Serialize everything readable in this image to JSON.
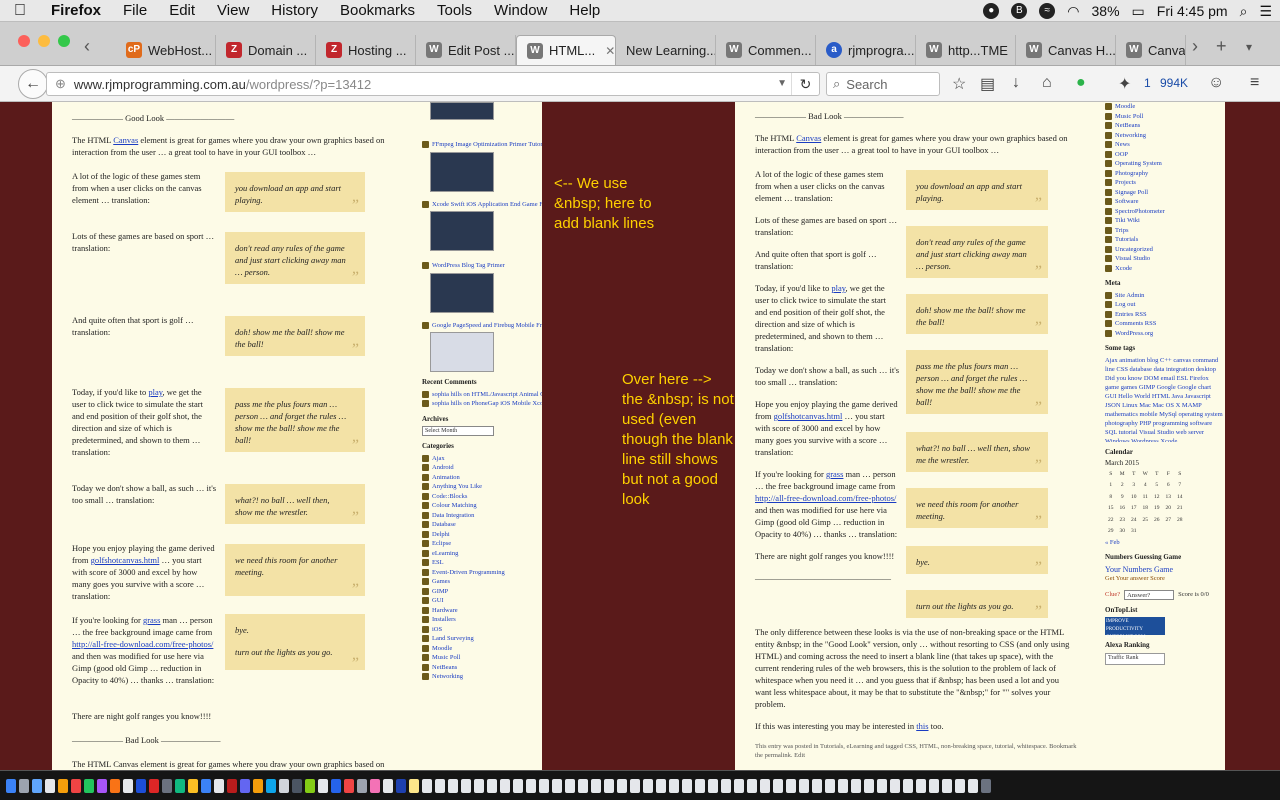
{
  "menubar": {
    "apple": "",
    "items": [
      "Firefox",
      "File",
      "Edit",
      "View",
      "History",
      "Bookmarks",
      "Tools",
      "Window",
      "Help"
    ],
    "battery": "38%",
    "clock": "Fri 4:45 pm"
  },
  "tabs": [
    {
      "label": "WebHost...",
      "icon": "cp-icon"
    },
    {
      "label": "Domain ...",
      "icon": "z-icon"
    },
    {
      "label": "Hosting ...",
      "icon": "z-icon"
    },
    {
      "label": "Edit Post ...",
      "icon": "wp-icon"
    },
    {
      "label": "HTML...",
      "icon": "wp-icon",
      "active": true
    },
    {
      "label": "New Learning...",
      "icon": "blank"
    },
    {
      "label": "Commen...",
      "icon": "wp-icon"
    },
    {
      "label": "rjmprogra...",
      "icon": "a-icon"
    },
    {
      "label": "http...TME",
      "icon": "wp-icon"
    },
    {
      "label": "Canvas H...",
      "icon": "wp-icon"
    },
    {
      "label": "Canvas",
      "icon": "wp-icon"
    }
  ],
  "navbar": {
    "url_host": "www.rjmprogramming.com.au",
    "url_path": "/wordpress/?p=13412",
    "search_placeholder": "Search",
    "badge": "1",
    "size": "994K"
  },
  "good": {
    "heading": "—————— Good Look ————————",
    "p1a": "The HTML ",
    "p1link": "Canvas",
    "p1b": " element is great for games where you draw your own graphics based on interaction from the user … a great tool to have in your GUI toolbox …",
    "p2": "A lot of the logic of these games stem from when a user clicks on the canvas element … translation:",
    "q1": "you download an app and start playing.",
    "p3": "Lots of these games are based on sport … translation:",
    "q2": "don't read any rules of the game and just start clicking away man … person.",
    "p4": "And quite often that sport is golf … translation:",
    "q3": "doh! show me the ball! show me the ball!",
    "p5a": "Today, if you'd like to ",
    "p5link": "play",
    "p5b": ", we get the user to click twice to simulate the start and end position of their golf shot, the direction and size of which is predetermined, and shown to them … translation:",
    "q4": "pass me the plus fours man … person … and forget the rules … show me the ball! show me the ball!",
    "p6": "Today we don't show a ball, as such … it's too small … translation:",
    "q5": "what?! no ball … well then, show me the wrestler.",
    "p7a": "Hope you enjoy playing the game derived from ",
    "p7link": "golfshotcanvas.html",
    "p7b": " … you start with score of 3000 and excel by how many goes you survive with a score … translation:",
    "q6": "we need this room for another meeting.",
    "p8a": "If you're looking for ",
    "p8link": "grass",
    "p8b": " man … person … the free background image came from ",
    "p8link2": "http://all-free-download.com/free-photos/",
    "p8c": " and then was modified for use here via Gimp (good old Gimp … reduction in Opacity to 40%) … thanks … translation:",
    "q7a": "bye.",
    "q7b": "turn out the lights as you go.",
    "p9": "There are night golf ranges you know!!!!",
    "bad_heading": "—————— Bad Look ———————",
    "p10": "The HTML Canvas element is great for games where you draw your own graphics based on"
  },
  "sidebar1": {
    "recent_items": [
      "FFmpeg Image Optimization Primer Tutorial",
      "Xcode Swift iOS Application End Game Follow Up Tutorial",
      "WordPress Blog Tag Primer",
      "Google PageSpeed and Firebug Mobile Friendly Primer Tutorial"
    ],
    "recent_comments_title": "Recent Comments",
    "comments": [
      "sophia hills on HTML/Javascript Animal Categorization Tutorial",
      "sophia hills on PhoneGap iOS Mobile Xcode Primer Tutorial"
    ],
    "archives_title": "Archives",
    "archives_select": "Select Month",
    "categories_title": "Categories",
    "categories": [
      "Ajax",
      "Android",
      "Animation",
      "Anything You Like",
      "Code::Blocks",
      "Colour Matching",
      "Data Integration",
      "Database",
      "Delphi",
      "Eclipse",
      "eLearning",
      "ESL",
      "Event-Driven Programming",
      "Games",
      "GIMP",
      "GUI",
      "Hardware",
      "Installers",
      "iOS",
      "Land Surveying",
      "Moodle",
      "Music Poll",
      "NetBeans",
      "Networking"
    ]
  },
  "notes": {
    "n1": "<-- We use &nbsp; here to add blank lines",
    "n2": "Over here --> the &nbsp; is not used (even though the blank line still shows but not a good look"
  },
  "bad": {
    "heading": "—————— Bad Look ———————",
    "p1a": "The HTML ",
    "p1link": "Canvas",
    "p1b": " element is great for games where you draw your own graphics based on interaction from the user … a great tool to have in your GUI toolbox …",
    "p2": "A lot of the logic of these games stem from when a user clicks on the canvas element … translation:",
    "p3": "Lots of these games are based on sport … translation:",
    "p4": "And quite often that sport is golf … translation:",
    "p5a": "Today, if you'd like to ",
    "p5link": "play",
    "p5b": ", we get the user to click twice to simulate the start and end position of their golf shot, the direction and size of which is predetermined, and shown to them … translation:",
    "p6": "Today we don't show a ball, as such … it's too small … translation:",
    "p7a": "Hope you enjoy playing the game derived from ",
    "p7link": "golfshotcanvas.html",
    "p7b": " … you start with score of 3000 and excel by how many goes you survive with a score … translation:",
    "p8a": "If you're looking for ",
    "p8link": "grass",
    "p8b": " man … person … the free background image came from ",
    "p8link2": "http://all-free-download.com/free-photos/",
    "p8c": " and then was modified for use here via Gimp (good old Gimp … reduction in Opacity to 40%) … thanks … translation:",
    "p9": "There are night golf ranges you know!!!!",
    "sep": "————————————————",
    "p10": "The only difference between these looks is via the use of non-breaking space or the HTML entity &nbsp; in the \"Good Look\" version, only … without resorting to CSS (and only using HTML) and coming across the need to insert a blank line (that takes up space), with the current rendering rules of the web browsers, this is the solution to the problem of lack of whitespace when you need it … and you guess that if &nbsp; has been used a lot and you want less whitespace about, it may be that to substitute the \"&nbsp;\" for \"\" solves your problem.",
    "p11a": "If this was interesting you may be interested in ",
    "p11link": "this",
    "p11b": " too.",
    "footer": "This entry was posted in Tutorials, eLearning and tagged CSS, HTML, non-breaking space, tutorial, whitespace. Bookmark the permalink. Edit",
    "quotes": [
      "you download an app and start playing.",
      "don't read any rules of the game and just start clicking away man … person.",
      "doh! show me the ball! show me the ball!",
      "pass me the plus fours man … person … and forget the rules … show me the ball! show me the ball!",
      "what?! no ball … well then, show me the wrestler.",
      "we need this room for another meeting.",
      "bye.",
      "turn out the lights as you go."
    ]
  },
  "sidebar2": {
    "cats": [
      "Moodle",
      "Music Poll",
      "NetBeans",
      "Networking",
      "News",
      "OOP",
      "Operating System",
      "Photography",
      "Projects",
      "Signage Poll",
      "Software",
      "SpectroPhotometer",
      "Tiki Wiki",
      "Trips",
      "Tutorials",
      "Uncategorized",
      "Visual Studio",
      "Xcode"
    ],
    "meta_title": "Meta",
    "meta": [
      "Site Admin",
      "Log out",
      "Entries RSS",
      "Comments RSS",
      "WordPress.org"
    ],
    "tags_title": "Some tags",
    "tags": "Ajax animation blog C++ canvas command line CSS database data integration desktop Did you know DOM email ESL Firefox game games GIMP Google Google chart GUI Hello World HTML Java Javascript JSON Linux Mac Mac OS X MAMP mathematics mobile MySql operating system photography PHP programming software SQL tutorial Visual Studio web server Windows Wordpress Xcode",
    "cal_title": "Calendar",
    "cal_month": "March 2015",
    "cal_days": [
      "S",
      "M",
      "T",
      "W",
      "T",
      "F",
      "S"
    ],
    "cal_rows": [
      [
        "1",
        "2",
        "3",
        "4",
        "5",
        "6",
        "7"
      ],
      [
        "8",
        "9",
        "10",
        "11",
        "12",
        "13",
        "14"
      ],
      [
        "15",
        "16",
        "17",
        "18",
        "19",
        "20",
        "21"
      ],
      [
        "22",
        "23",
        "24",
        "25",
        "26",
        "27",
        "28"
      ],
      [
        "29",
        "30",
        "31",
        "",
        "",
        "",
        ""
      ]
    ],
    "cal_prev": "« Feb",
    "game_title": "Numbers Guessing Game",
    "game_sub": "Your Numbers Game",
    "game_cols": "Get Your answer Score",
    "clue": "Clue?",
    "answer": "Answer?",
    "score": "Score is 0/0",
    "ontop": "OnTopList",
    "ontop_badge": "IMPROVE PRODUCTIVITY ONTOPLIST.COM",
    "alexa": "Alexa Ranking",
    "alexa_badge": "Traffic Rank"
  }
}
